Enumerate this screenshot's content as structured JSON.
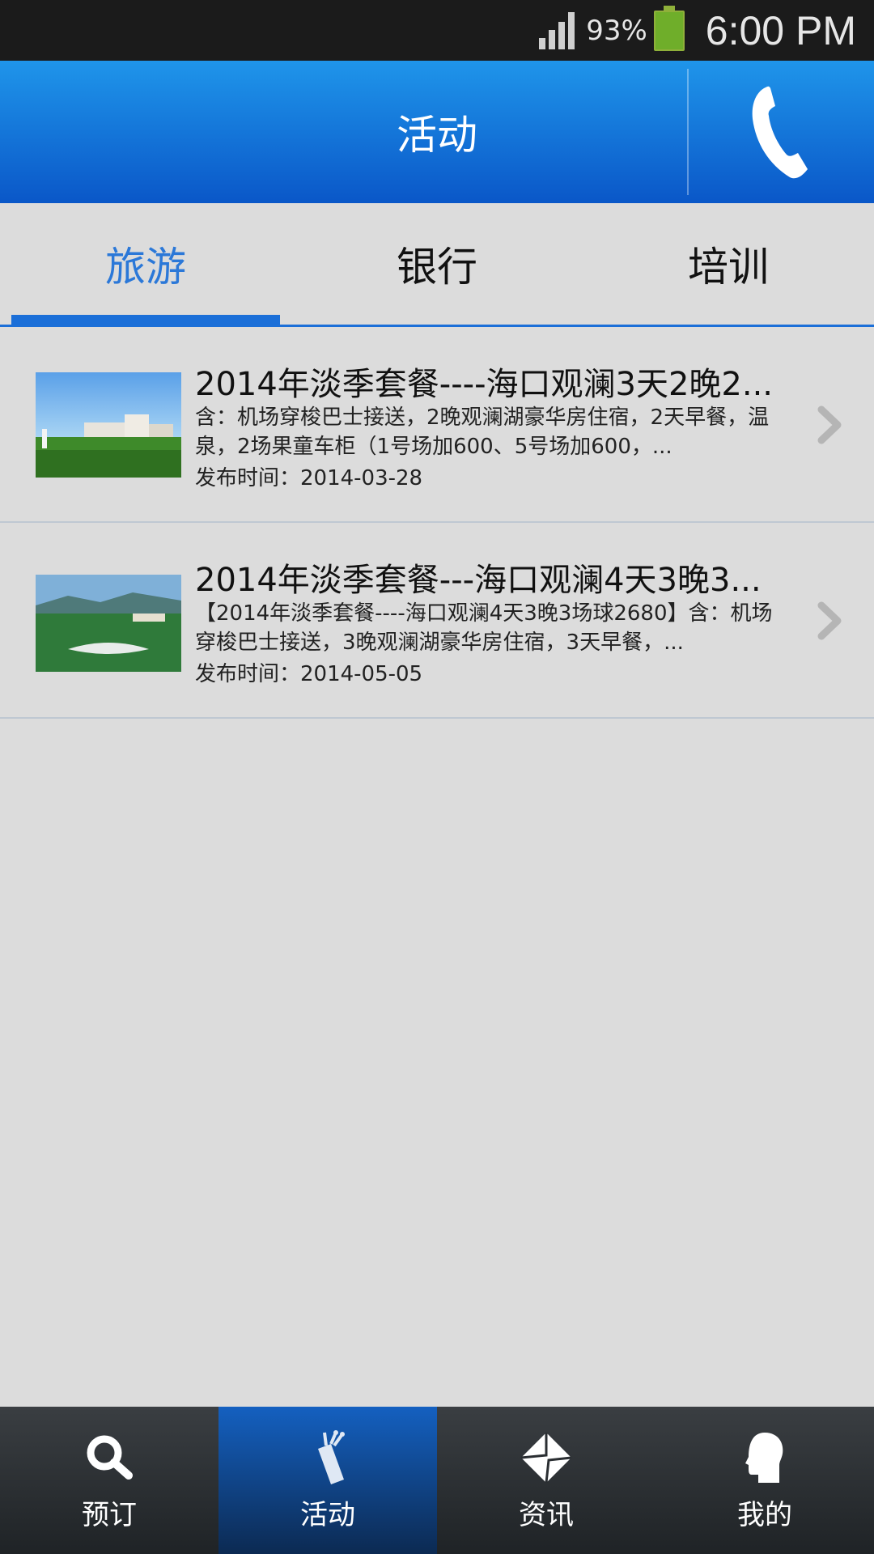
{
  "status_bar": {
    "battery": "93%",
    "time": "6:00 PM"
  },
  "header": {
    "title": "活动",
    "phone_icon": "phone-icon"
  },
  "tabs": [
    {
      "label": "旅游",
      "active": true
    },
    {
      "label": "银行",
      "active": false
    },
    {
      "label": "培训",
      "active": false
    }
  ],
  "items": [
    {
      "title": "2014年淡季套餐----海口观澜3天2晚2...",
      "desc": "含：机场穿梭巴士接送，2晚观澜湖豪华房住宿，2天早餐，温泉，2场果童车柜（1号场加600、5号场加600，...",
      "date": "发布时间：2014-03-28"
    },
    {
      "title": "2014年淡季套餐---海口观澜4天3晚3...",
      "desc": "【2014年淡季套餐----海口观澜4天3晚3场球2680】含：机场穿梭巴士接送，3晚观澜湖豪华房住宿，3天早餐，...",
      "date": "发布时间：2014-05-05"
    }
  ],
  "bottom_nav": [
    {
      "label": "预订",
      "icon": "search-icon",
      "active": false
    },
    {
      "label": "活动",
      "icon": "golf-bag-icon",
      "active": true
    },
    {
      "label": "资讯",
      "icon": "envelope-icon",
      "active": false
    },
    {
      "label": "我的",
      "icon": "profile-head-icon",
      "active": false
    }
  ]
}
